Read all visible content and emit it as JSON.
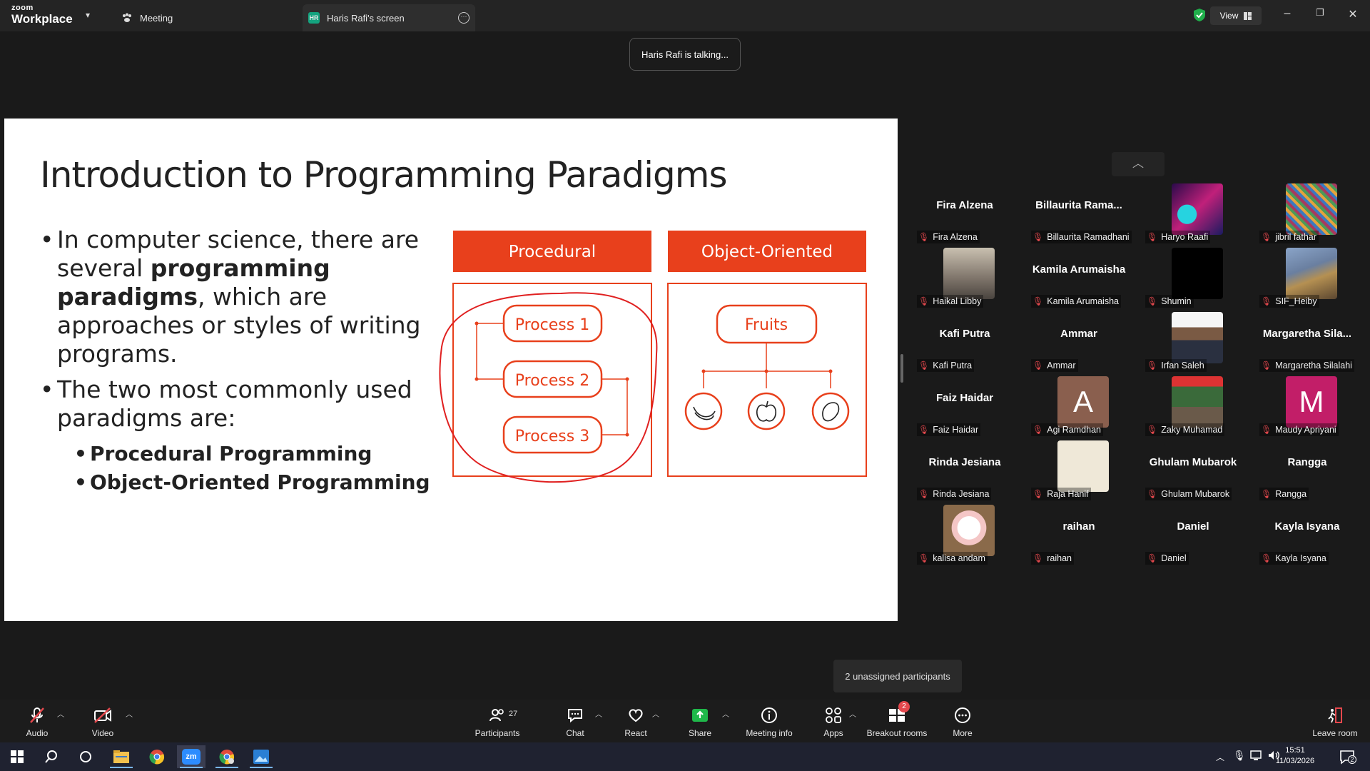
{
  "app": {
    "brand_small": "zoom",
    "brand_big": "Workplace",
    "tab_meeting": "Meeting",
    "tab_screen_badge": "HR",
    "tab_screen": "Haris Rafi's screen",
    "view_label": "View",
    "talking": "Haris Rafi is talking..."
  },
  "slide": {
    "title": "Introduction to Programming Paradigms",
    "bullet1_part1": "In computer science, there are several ",
    "bullet1_bold": "programming paradigms",
    "bullet1_part2": ", which are approaches or styles of writing programs.",
    "bullet2": "The two most commonly used paradigms are:",
    "sub1": "Procedural Programming",
    "sub2": "Object-Oriented Programming",
    "diagram": {
      "procedural_header": "Procedural",
      "oop_header": "Object-Oriented",
      "process1": "Process 1",
      "process2": "Process 2",
      "process3": "Process 3",
      "fruits": "Fruits",
      "accent": "#e8401c"
    }
  },
  "participants": [
    {
      "tile": "Fira Alzena",
      "tag": "Fira Alzena",
      "thumb": null
    },
    {
      "tile": "Billaurita  Rama...",
      "tag": "Billaurita Ramadhani",
      "thumb": null
    },
    {
      "tile": "",
      "tag": "Haryo Raafi",
      "thumb": "wave"
    },
    {
      "tile": "",
      "tag": "jibril fathar",
      "thumb": "mosaic"
    },
    {
      "tile": "",
      "tag": "Haikal Libby",
      "thumb": "photo-grey"
    },
    {
      "tile": "Kamila Arumaisha",
      "tag": "Kamila Arumaisha",
      "thumb": null
    },
    {
      "tile": "",
      "tag": "Shumin",
      "thumb": "black"
    },
    {
      "tile": "",
      "tag": "SIF_Heiby",
      "thumb": "photo-dog"
    },
    {
      "tile": "Kafi Putra",
      "tag": "Kafi Putra",
      "thumb": null
    },
    {
      "tile": "Ammar",
      "tag": "Ammar",
      "thumb": null
    },
    {
      "tile": "",
      "tag": "Irfan Saleh",
      "thumb": "portrait"
    },
    {
      "tile": "Margaretha  Sila...",
      "tag": "Margaretha Silalahi",
      "thumb": null
    },
    {
      "tile": "Faiz Haidar",
      "tag": "Faiz Haidar",
      "thumb": null
    },
    {
      "tile": "",
      "tag": "Agi Ramdhan",
      "thumb": "letter-A"
    },
    {
      "tile": "",
      "tag": "Zaky Muhamad",
      "thumb": "sports"
    },
    {
      "tile": "",
      "tag": "Maudy Apriyani",
      "thumb": "letter-M"
    },
    {
      "tile": "Rinda Jesiana",
      "tag": "Rinda Jesiana",
      "thumb": null
    },
    {
      "tile": "",
      "tag": "Raja Hanif",
      "thumb": "beige"
    },
    {
      "tile": "Ghulam Mubarok",
      "tag": "Ghulam Mubarok",
      "thumb": null
    },
    {
      "tile": "Rangga",
      "tag": "Rangga",
      "thumb": null
    },
    {
      "tile": "",
      "tag": "kalisa andam",
      "thumb": "kitty"
    },
    {
      "tile": "raihan",
      "tag": "raihan",
      "thumb": null
    },
    {
      "tile": "Daniel",
      "tag": "Daniel",
      "thumb": null
    },
    {
      "tile": "Kayla Isyana",
      "tag": "Kayla Isyana",
      "thumb": null
    }
  ],
  "thumb_letters": {
    "letter-A": "A",
    "letter-M": "M"
  },
  "unassigned": "2 unassigned participants",
  "toolbar": {
    "audio": "Audio",
    "video": "Video",
    "participants": "Participants",
    "participants_count": "27",
    "chat": "Chat",
    "react": "React",
    "share": "Share",
    "meeting_info": "Meeting info",
    "apps": "Apps",
    "breakout": "Breakout rooms",
    "breakout_badge": "2",
    "more": "More",
    "leave": "Leave room"
  },
  "taskbar": {
    "time": "15:51",
    "date": "11/03/2026",
    "notif": "2",
    "zoom_label": "zm"
  }
}
